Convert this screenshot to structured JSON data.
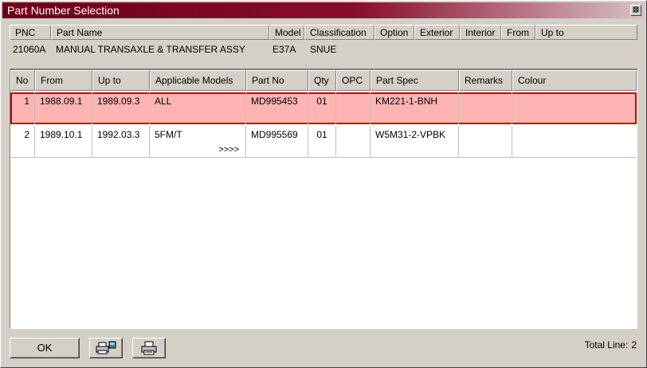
{
  "window": {
    "title": "Part Number Selection",
    "close_glyph": "⊠"
  },
  "header": {
    "columns": [
      "PNC",
      "Part Name",
      "Model",
      "Classification",
      "Option",
      "Exterior",
      "Interior",
      "From",
      "Up to"
    ],
    "values": {
      "pnc": "21060A",
      "part_name": "MANUAL TRANSAXLE & TRANSFER ASSY",
      "model": "E37A",
      "classification": "SNUE"
    }
  },
  "table": {
    "columns": [
      "No",
      "From",
      "Up to",
      "Applicable Models",
      "Part No",
      "Qty",
      "OPC",
      "Part Spec",
      "Remarks",
      "Colour"
    ],
    "rows": [
      {
        "no": "1",
        "from": "1988.09.1",
        "up_to": "1989.09.3",
        "models": "ALL",
        "more": "",
        "part_no": "MD995453",
        "qty": "01",
        "opc": "",
        "spec": "KM221-1-BNH",
        "remarks": "",
        "colour": ""
      },
      {
        "no": "2",
        "from": "1989.10.1",
        "up_to": "1992.03.3",
        "models": "5FM/T",
        "more": ">>>>",
        "part_no": "MD995569",
        "qty": "01",
        "opc": "",
        "spec": "W5M31-2-VPBK",
        "remarks": "",
        "colour": ""
      }
    ],
    "selected_row": 1,
    "selection_color": "#ffb4b4"
  },
  "footer": {
    "ok_label": "OK",
    "print_preview_icon": "printer-preview-icon",
    "print_icon": "printer-icon",
    "total_label": "Total Line:",
    "total_value": "2"
  }
}
